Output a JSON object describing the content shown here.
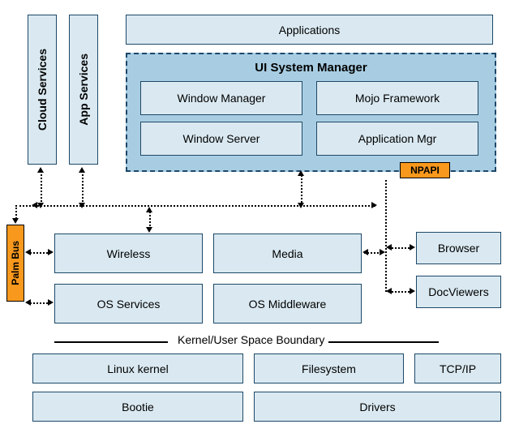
{
  "top": {
    "applications": "Applications",
    "cloud_services": "Cloud Services",
    "app_services": "App Services"
  },
  "ui_sys": {
    "title": "UI System Manager",
    "window_manager": "Window Manager",
    "mojo_framework": "Mojo Framework",
    "window_server": "Window Server",
    "application_mgr": "Application Mgr",
    "npapi": "NPAPI"
  },
  "bus": {
    "palm_bus": "Palm Bus"
  },
  "mid": {
    "wireless": "Wireless",
    "media": "Media",
    "os_services": "OS Services",
    "os_middleware": "OS Middleware",
    "browser": "Browser",
    "docviewers": "DocViewers"
  },
  "boundary": {
    "label": "Kernel/User Space Boundary"
  },
  "kernel": {
    "linux_kernel": "Linux kernel",
    "filesystem": "Filesystem",
    "tcp_ip": "TCP/IP",
    "bootie": "Bootie",
    "drivers": "Drivers"
  }
}
